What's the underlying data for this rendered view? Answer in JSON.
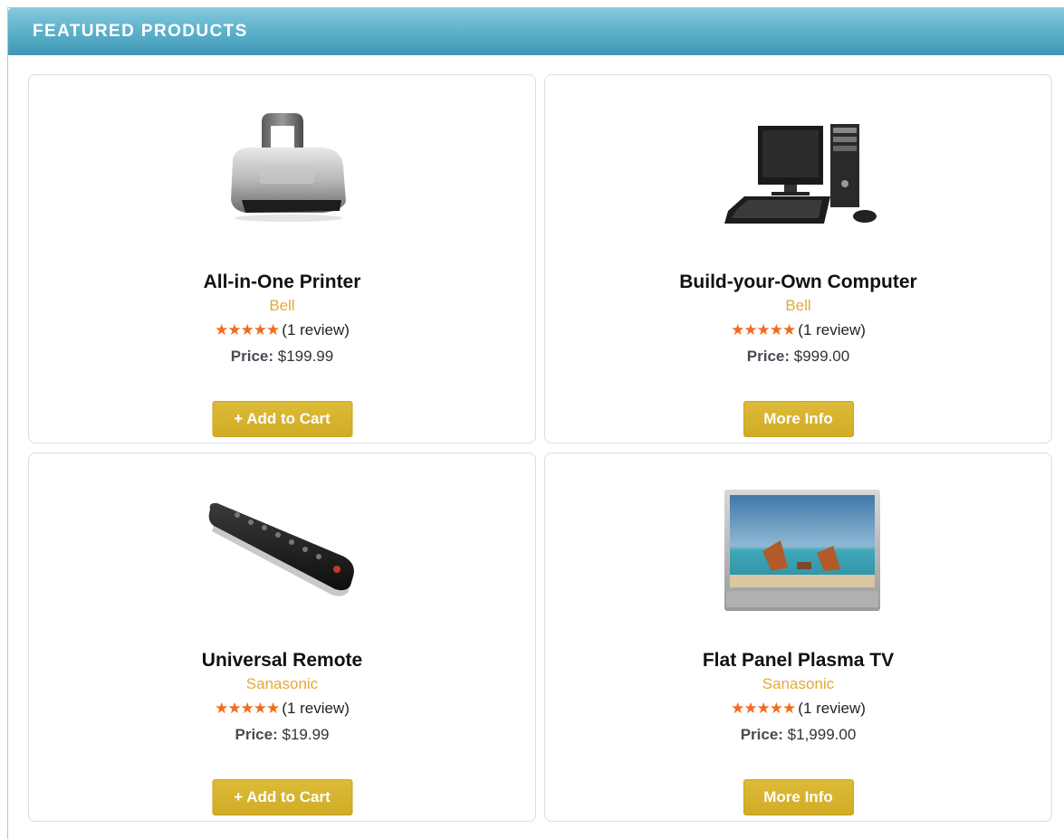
{
  "header": {
    "title": "FEATURED PRODUCTS"
  },
  "products": [
    {
      "name": "All-in-One Printer",
      "brand": "Bell",
      "stars": "★★★★★",
      "reviews": "(1 review)",
      "price_label": "Price:",
      "price": "$199.99",
      "button": "+ Add to Cart",
      "icon": "printer-image"
    },
    {
      "name": "Build-your-Own Computer",
      "brand": "Bell",
      "stars": "★★★★★",
      "reviews": "(1 review)",
      "price_label": "Price:",
      "price": "$999.00",
      "button": "More Info",
      "icon": "desktop-computer-image"
    },
    {
      "name": "Universal Remote",
      "brand": "Sanasonic",
      "stars": "★★★★★",
      "reviews": "(1 review)",
      "price_label": "Price:",
      "price": "$19.99",
      "button": "+ Add to Cart",
      "icon": "remote-control-image"
    },
    {
      "name": "Flat Panel Plasma TV",
      "brand": "Sanasonic",
      "stars": "★★★★★",
      "reviews": "(1 review)",
      "price_label": "Price:",
      "price": "$1,999.00",
      "button": "More Info",
      "icon": "plasma-tv-image"
    }
  ],
  "colors": {
    "header": "#5aaec8",
    "brand": "#e3a93b",
    "stars": "#f26b1d",
    "button": "#d4b02c"
  }
}
